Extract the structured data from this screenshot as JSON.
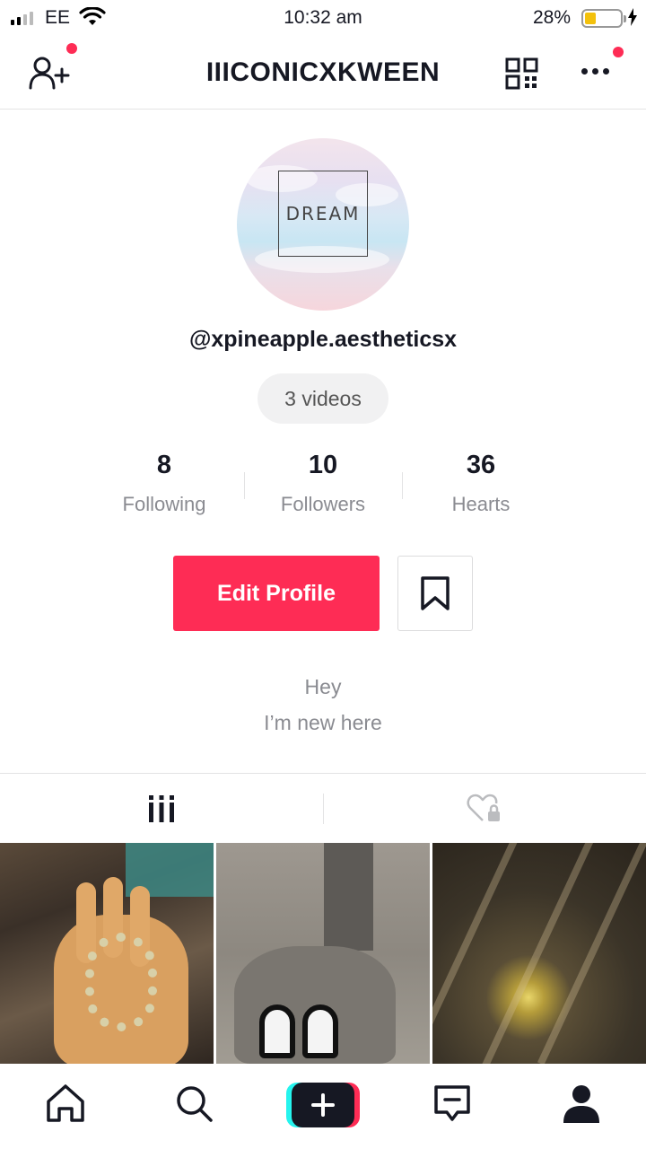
{
  "status_bar": {
    "carrier": "EE",
    "time": "10:32 am",
    "battery": "28%",
    "battery_level": 0.28
  },
  "header": {
    "title": "IIICONICXKWEEN",
    "notification_color": "#fe2c55"
  },
  "profile": {
    "avatar_text": "DREAM",
    "username": "@xpineapple.aestheticsx",
    "videos_count": "3 videos",
    "stats": [
      {
        "value": "8",
        "label": "Following"
      },
      {
        "value": "10",
        "label": "Followers"
      },
      {
        "value": "36",
        "label": "Hearts"
      }
    ],
    "edit_button": "Edit Profile",
    "bio_line1": "Hey",
    "bio_line2": "I’m new here"
  },
  "tabs": [
    {
      "icon": "video-grid-icon",
      "active": true
    },
    {
      "icon": "liked-private-icon",
      "active": false
    }
  ],
  "bottom_nav": [
    {
      "icon": "home-icon"
    },
    {
      "icon": "search-icon"
    },
    {
      "icon": "create-plus-icon"
    },
    {
      "icon": "inbox-icon"
    },
    {
      "icon": "profile-icon",
      "active": true
    }
  ],
  "colors": {
    "accent": "#fe2c55",
    "create_cyan": "#25f4ee",
    "text_primary": "#161823",
    "text_secondary": "#8a8b91"
  }
}
